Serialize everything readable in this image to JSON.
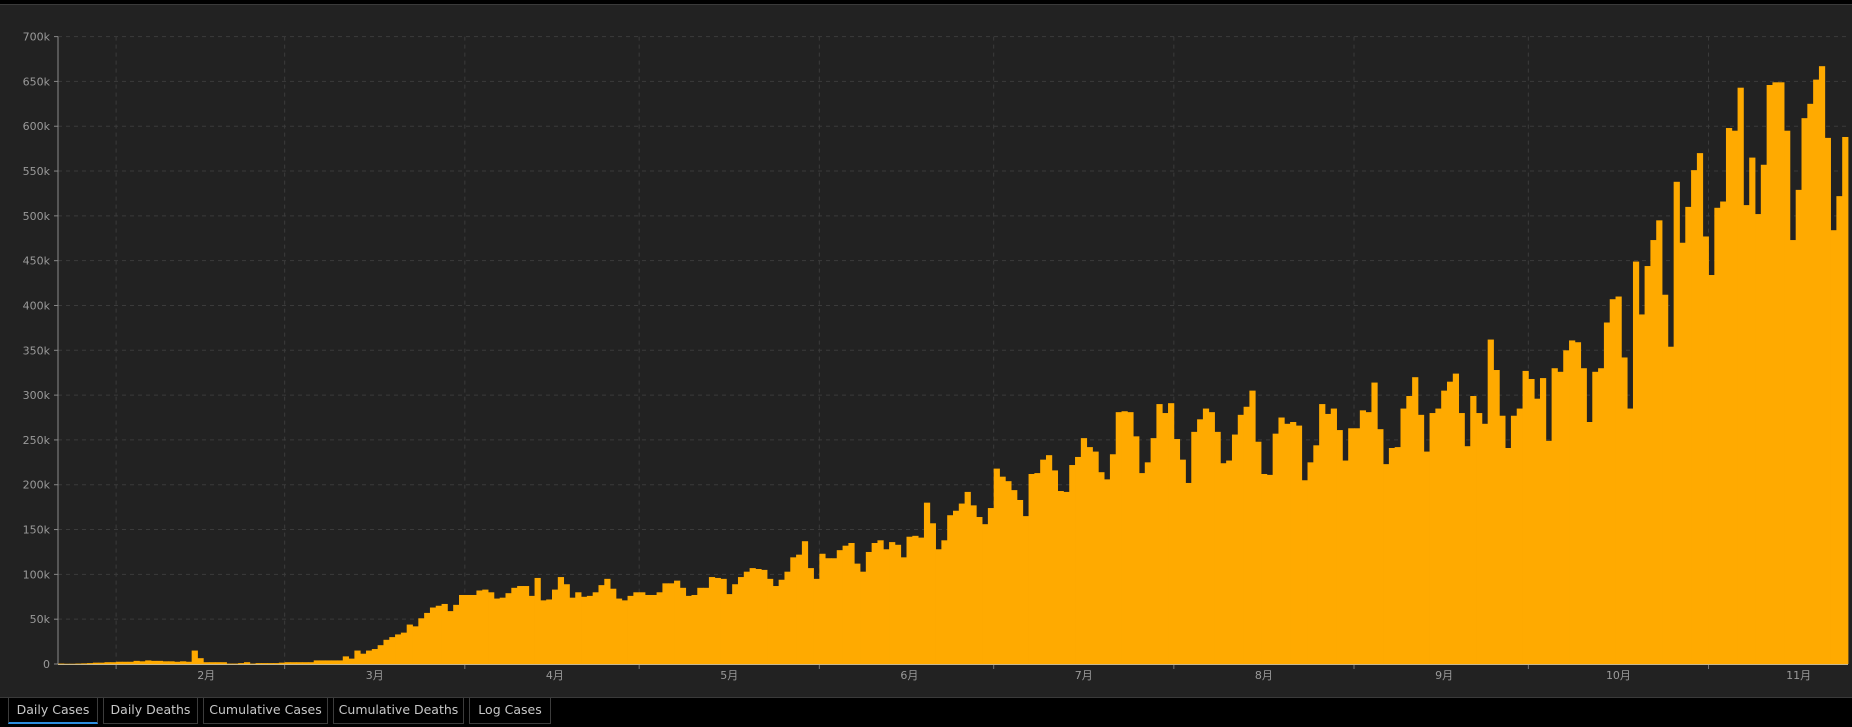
{
  "tabs": [
    {
      "label": "Daily Cases",
      "active": true
    },
    {
      "label": "Daily Deaths",
      "active": false
    },
    {
      "label": "Cumulative Cases",
      "active": false
    },
    {
      "label": "Cumulative Deaths",
      "active": false
    },
    {
      "label": "Log Cases",
      "active": false
    }
  ],
  "colors": {
    "bar": "#FFAA00",
    "background": "#222222",
    "accent": "#2d8ee0"
  },
  "chart_data": {
    "type": "bar",
    "title": "",
    "xlabel": "",
    "ylabel": "",
    "x_start": "2020-01-22",
    "x_end": "2020-11-24",
    "unit": "thousands of cases per day",
    "ylim": [
      0,
      700
    ],
    "yticks": [
      0,
      50,
      100,
      150,
      200,
      250,
      300,
      350,
      400,
      450,
      500,
      550,
      600,
      650,
      700
    ],
    "ytick_labels": [
      "0",
      "50k",
      "100k",
      "150k",
      "200k",
      "250k",
      "300k",
      "350k",
      "400k",
      "450k",
      "500k",
      "550k",
      "600k",
      "650k",
      "700k"
    ],
    "month_starts_day_index": [
      10,
      39,
      70,
      100,
      131,
      161,
      192,
      223,
      253,
      284
    ],
    "month_labels": [
      "2月",
      "3月",
      "4月",
      "5月",
      "6月",
      "7月",
      "8月",
      "9月",
      "10月",
      "11月"
    ],
    "grid": true,
    "values": [
      0.5,
      0.3,
      0.3,
      0.5,
      0.7,
      1,
      1.5,
      1.5,
      2,
      2,
      2.5,
      2.5,
      2.5,
      3.5,
      3,
      4,
      3.5,
      3.5,
      3,
      3,
      2.5,
      3,
      2.5,
      15,
      6.5,
      2,
      2,
      2,
      2,
      0.5,
      0.5,
      1,
      2,
      0.5,
      1,
      1,
      1,
      1,
      1.5,
      2,
      2,
      2,
      2,
      2,
      4,
      4,
      4,
      4,
      4,
      8.5,
      6,
      15,
      11.5,
      15,
      16.7,
      21,
      27,
      30,
      33,
      35,
      44,
      42,
      51,
      57,
      63,
      65,
      67,
      59,
      66,
      77,
      77,
      77,
      82,
      83,
      80,
      73,
      74,
      79,
      85,
      87,
      87,
      76,
      96,
      71,
      72,
      83,
      97,
      89,
      74,
      80,
      75,
      76,
      80,
      88,
      95,
      84,
      73,
      71,
      76,
      80,
      80,
      77,
      77,
      80,
      90,
      90,
      93,
      85,
      76,
      77,
      85,
      85,
      97,
      96,
      95,
      78,
      89,
      97,
      103,
      107,
      106,
      105,
      95,
      87,
      94,
      103,
      119,
      122,
      137,
      107,
      95,
      123,
      118,
      118,
      127,
      132,
      135,
      112,
      103,
      125,
      135,
      138,
      128,
      136,
      133,
      119,
      142,
      143,
      141,
      180,
      157,
      128,
      138,
      166,
      171,
      179,
      192,
      177,
      164,
      156,
      174,
      218,
      209,
      204,
      194,
      183,
      165,
      212,
      213,
      228,
      233,
      216,
      193,
      192,
      222,
      231,
      252,
      242,
      237,
      214,
      206,
      234,
      281,
      282,
      281,
      254,
      213,
      225,
      252,
      290,
      280,
      291,
      251,
      228,
      202,
      259,
      273,
      285,
      281,
      259,
      224,
      227,
      256,
      278,
      287,
      305,
      248,
      212,
      211,
      257,
      275,
      268,
      270,
      266,
      205,
      225,
      244,
      290,
      279,
      285,
      261,
      227,
      263,
      263,
      283,
      281,
      314,
      262,
      223,
      241,
      242,
      285,
      299,
      320,
      278,
      237,
      280,
      285,
      305,
      315,
      324,
      280,
      243,
      299,
      280,
      268,
      362,
      328,
      277,
      241,
      277,
      285,
      327,
      318,
      296,
      319,
      249,
      330,
      326,
      350,
      361,
      359,
      330,
      270,
      326,
      330,
      381,
      407,
      410,
      342,
      285,
      449,
      390,
      444,
      473,
      495,
      412,
      354,
      538,
      470,
      510,
      551,
      570,
      477,
      434,
      509,
      516,
      598,
      595,
      643,
      512,
      565,
      502,
      557,
      646,
      649,
      649,
      595,
      473,
      529,
      609,
      625,
      652,
      667,
      587,
      484,
      522,
      588
    ]
  }
}
